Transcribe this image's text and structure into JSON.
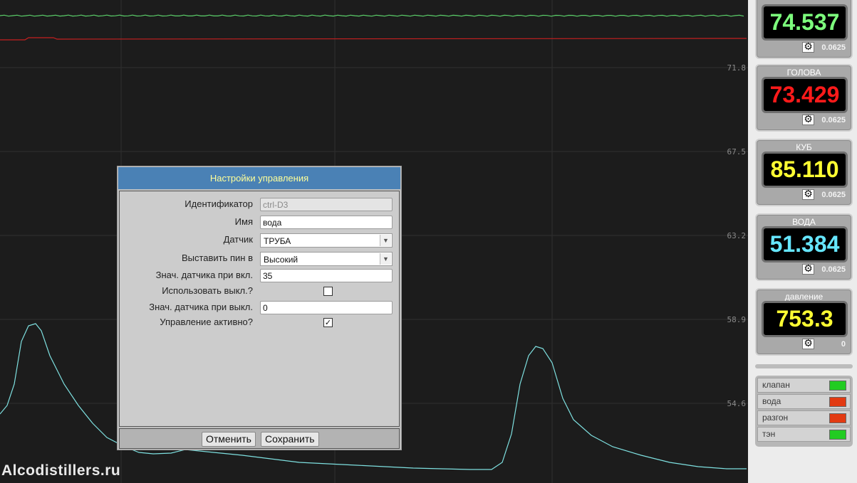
{
  "chart": {
    "y_ticks": [
      "71.8",
      "67.5",
      "63.2",
      "58.9",
      "54.6"
    ],
    "series_colors": {
      "green": "#5bd06a",
      "red": "#c62020",
      "cyan": "#7ee0e0"
    },
    "grid_color": "#2f2f2f"
  },
  "watermark": "Alcodistillers.ru",
  "sensors": [
    {
      "name": "",
      "value": "74.537",
      "color": "#7dff7d",
      "delta": "0.0625",
      "icon": "gear-icon"
    },
    {
      "name": "ГОЛОВА",
      "value": "73.429",
      "color": "#ff1a1a",
      "delta": "0.0625",
      "icon": "gear-icon"
    },
    {
      "name": "КУБ",
      "value": "85.110",
      "color": "#ffff33",
      "delta": "0.0625",
      "icon": "gear-icon"
    },
    {
      "name": "ВОДА",
      "value": "51.384",
      "color": "#66e6ff",
      "delta": "0.0625",
      "icon": "gear-icon"
    },
    {
      "name": "давление",
      "value": "753.3",
      "color": "#ffff33",
      "delta": "0",
      "icon": "gear-icon"
    }
  ],
  "outputs": [
    {
      "label": "клапан",
      "led": "#22cc22"
    },
    {
      "label": "вода",
      "led": "#e23a12"
    },
    {
      "label": "разгон",
      "led": "#e23a12"
    },
    {
      "label": "тэн",
      "led": "#22cc22"
    }
  ],
  "dialog": {
    "title": "Настройки управления",
    "id_label": "Идентификатор",
    "id_value": "ctrl-D3",
    "name_label": "Имя",
    "name_value": "вода",
    "sensor_label": "Датчик",
    "sensor_value": "ТРУБА",
    "pin_label": "Выставить пин в",
    "pin_value": "Высокий",
    "on_label": "Знач. датчика при вкл.",
    "on_value": "35",
    "use_off_label": "Использовать выкл.?",
    "use_off_checked": false,
    "off_label": "Знач. датчика при выкл.",
    "off_value": "0",
    "active_label": "Управление активно?",
    "active_checked": true,
    "cancel_label": "Отменить",
    "save_label": "Сохранить"
  }
}
